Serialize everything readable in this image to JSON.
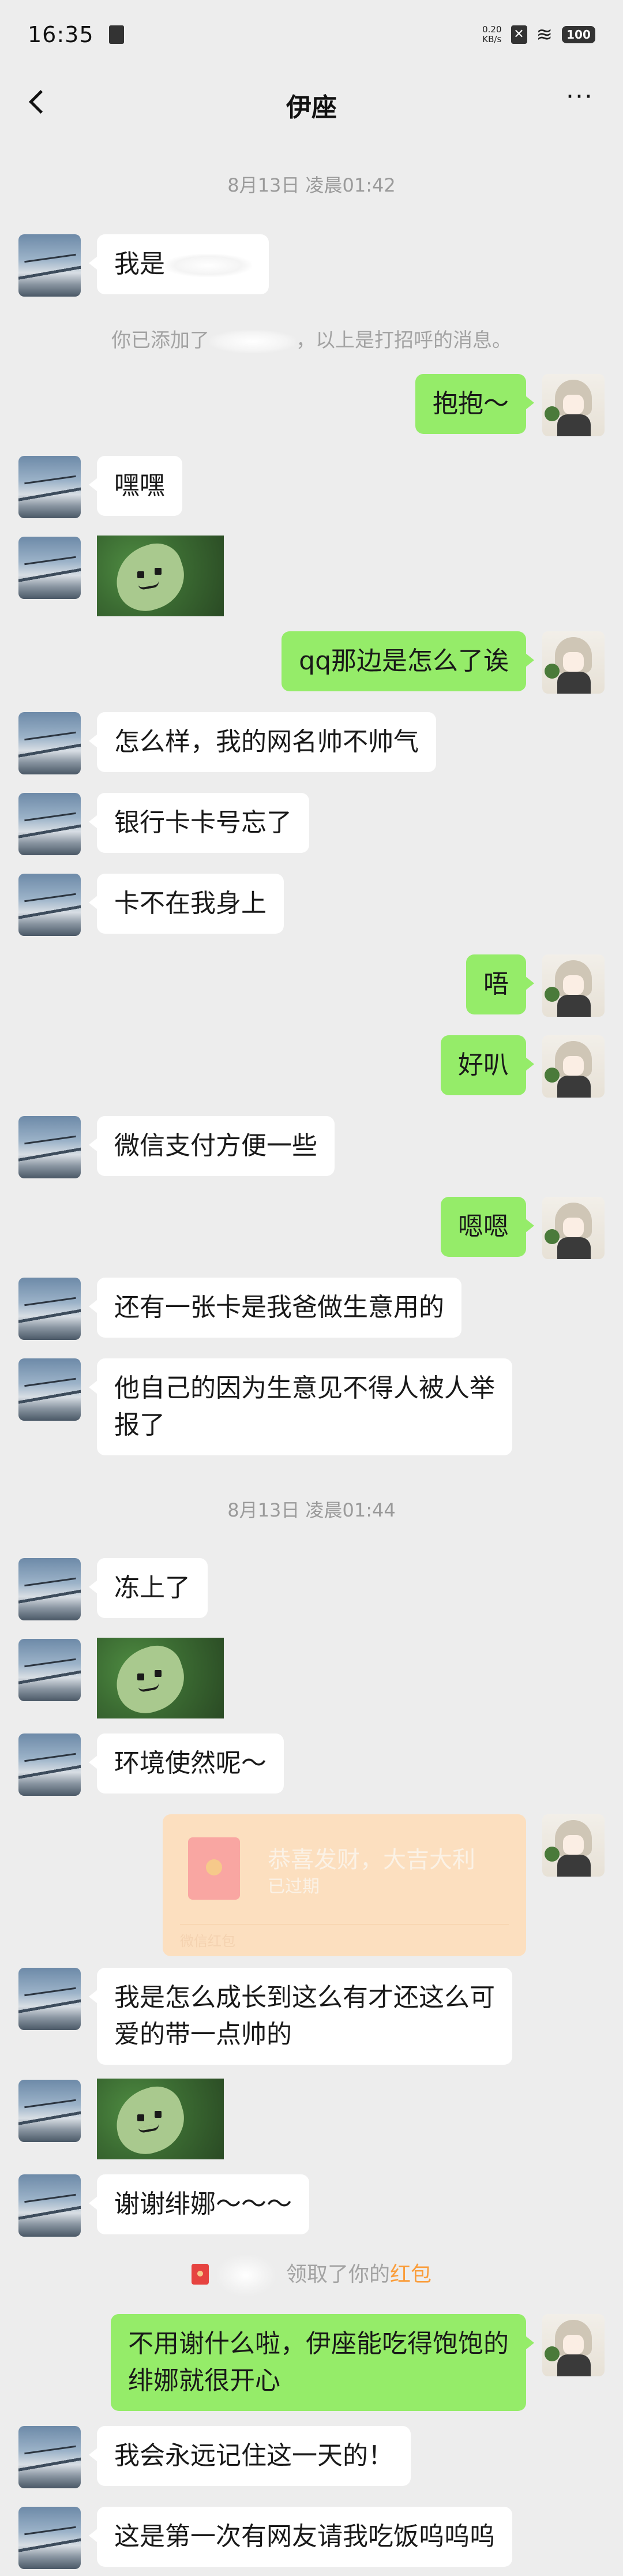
{
  "status_bar": {
    "time": "16:35",
    "net_speed_value": "0.20",
    "net_speed_unit": "KB/s",
    "battery": "100"
  },
  "header": {
    "title": "伊座"
  },
  "timestamps": [
    "8月13日 凌晨01:42",
    "8月13日 凌晨01:44"
  ],
  "system": {
    "added_prefix": "你已添加了",
    "added_suffix": "，以上是打招呼的消息。",
    "red_packet_notice_text": "领取了你的",
    "red_packet_notice_accent": "红包"
  },
  "messages": {
    "m1": "我是",
    "m2": "抱抱～",
    "m3": "嘿嘿",
    "m4": "qq那边是怎么了诶",
    "m5": "怎么样，我的网名帅不帅气",
    "m6": "银行卡卡号忘了",
    "m7": "卡不在我身上",
    "m8": "唔",
    "m9": "好叭",
    "m10": "微信支付方便一些",
    "m11": "嗯嗯",
    "m12": "还有一张卡是我爸做生意用的",
    "m13": "他自己的因为生意见不得人被人举\n报了",
    "m14": "冻上了",
    "m15": "环境使然呢～",
    "m16": "我是怎么成长到这么有才还这么可\n爱的带一点帅的",
    "m17": "谢谢绯娜～～～",
    "m18": "不用谢什么啦，伊座能吃得饱饱的\n绯娜就很开心",
    "m19": "我会永远记住这一天的！",
    "m20": "这是第一次有网友请我吃饭呜呜呜"
  },
  "red_packet": {
    "title": "恭喜发财，大吉大利",
    "status": "已过期",
    "footer": "微信红包"
  },
  "colors": {
    "background": "#ededed",
    "sent_bubble": "#95ec69",
    "received_bubble": "#ffffff",
    "red_packet_expired": "#fcdfbf",
    "accent": "#fa9d3b"
  }
}
